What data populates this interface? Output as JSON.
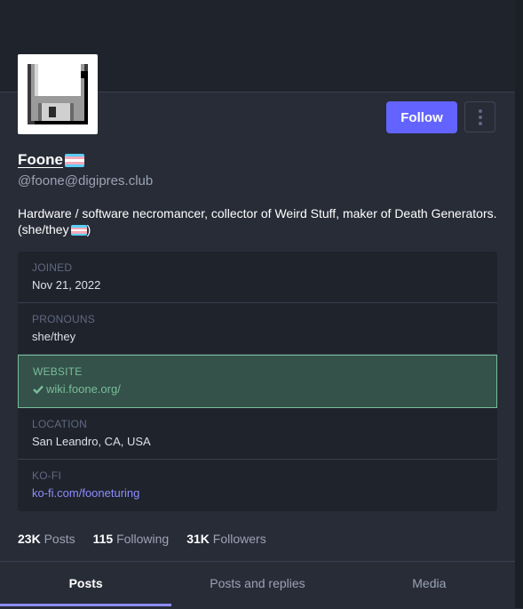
{
  "profile": {
    "display_name": "Foone",
    "handle": "@foone@digipres.club",
    "bio_text": "Hardware / software necromancer, collector of Weird Stuff, maker of Death Generators. (she/they",
    "bio_end": ")",
    "avatar_icon": "floppy-disk-icon"
  },
  "actions": {
    "follow_label": "Follow",
    "more_icon": "vertical-ellipsis-icon"
  },
  "fields": {
    "joined": {
      "label": "JOINED",
      "value": "Nov 21, 2022"
    },
    "pronouns": {
      "label": "PRONOUNS",
      "value": "she/they"
    },
    "website": {
      "label": "WEBSITE",
      "value": "wiki.foone.org/",
      "icon": "checkmark-icon"
    },
    "location": {
      "label": "LOCATION",
      "value": "San Leandro, CA, USA"
    },
    "kofi": {
      "label": "KO-FI",
      "value": "ko-fi.com/fooneturing"
    }
  },
  "stats": {
    "posts": {
      "num": "23K",
      "label": "Posts"
    },
    "following": {
      "num": "115",
      "label": "Following"
    },
    "followers": {
      "num": "31K",
      "label": "Followers"
    }
  },
  "tabs": {
    "posts": "Posts",
    "posts_replies": "Posts and replies",
    "media": "Media"
  },
  "colors": {
    "accent": "#6364ff",
    "verified": "#79bd9a",
    "link": "#8c8dff",
    "background": "#282c37"
  }
}
